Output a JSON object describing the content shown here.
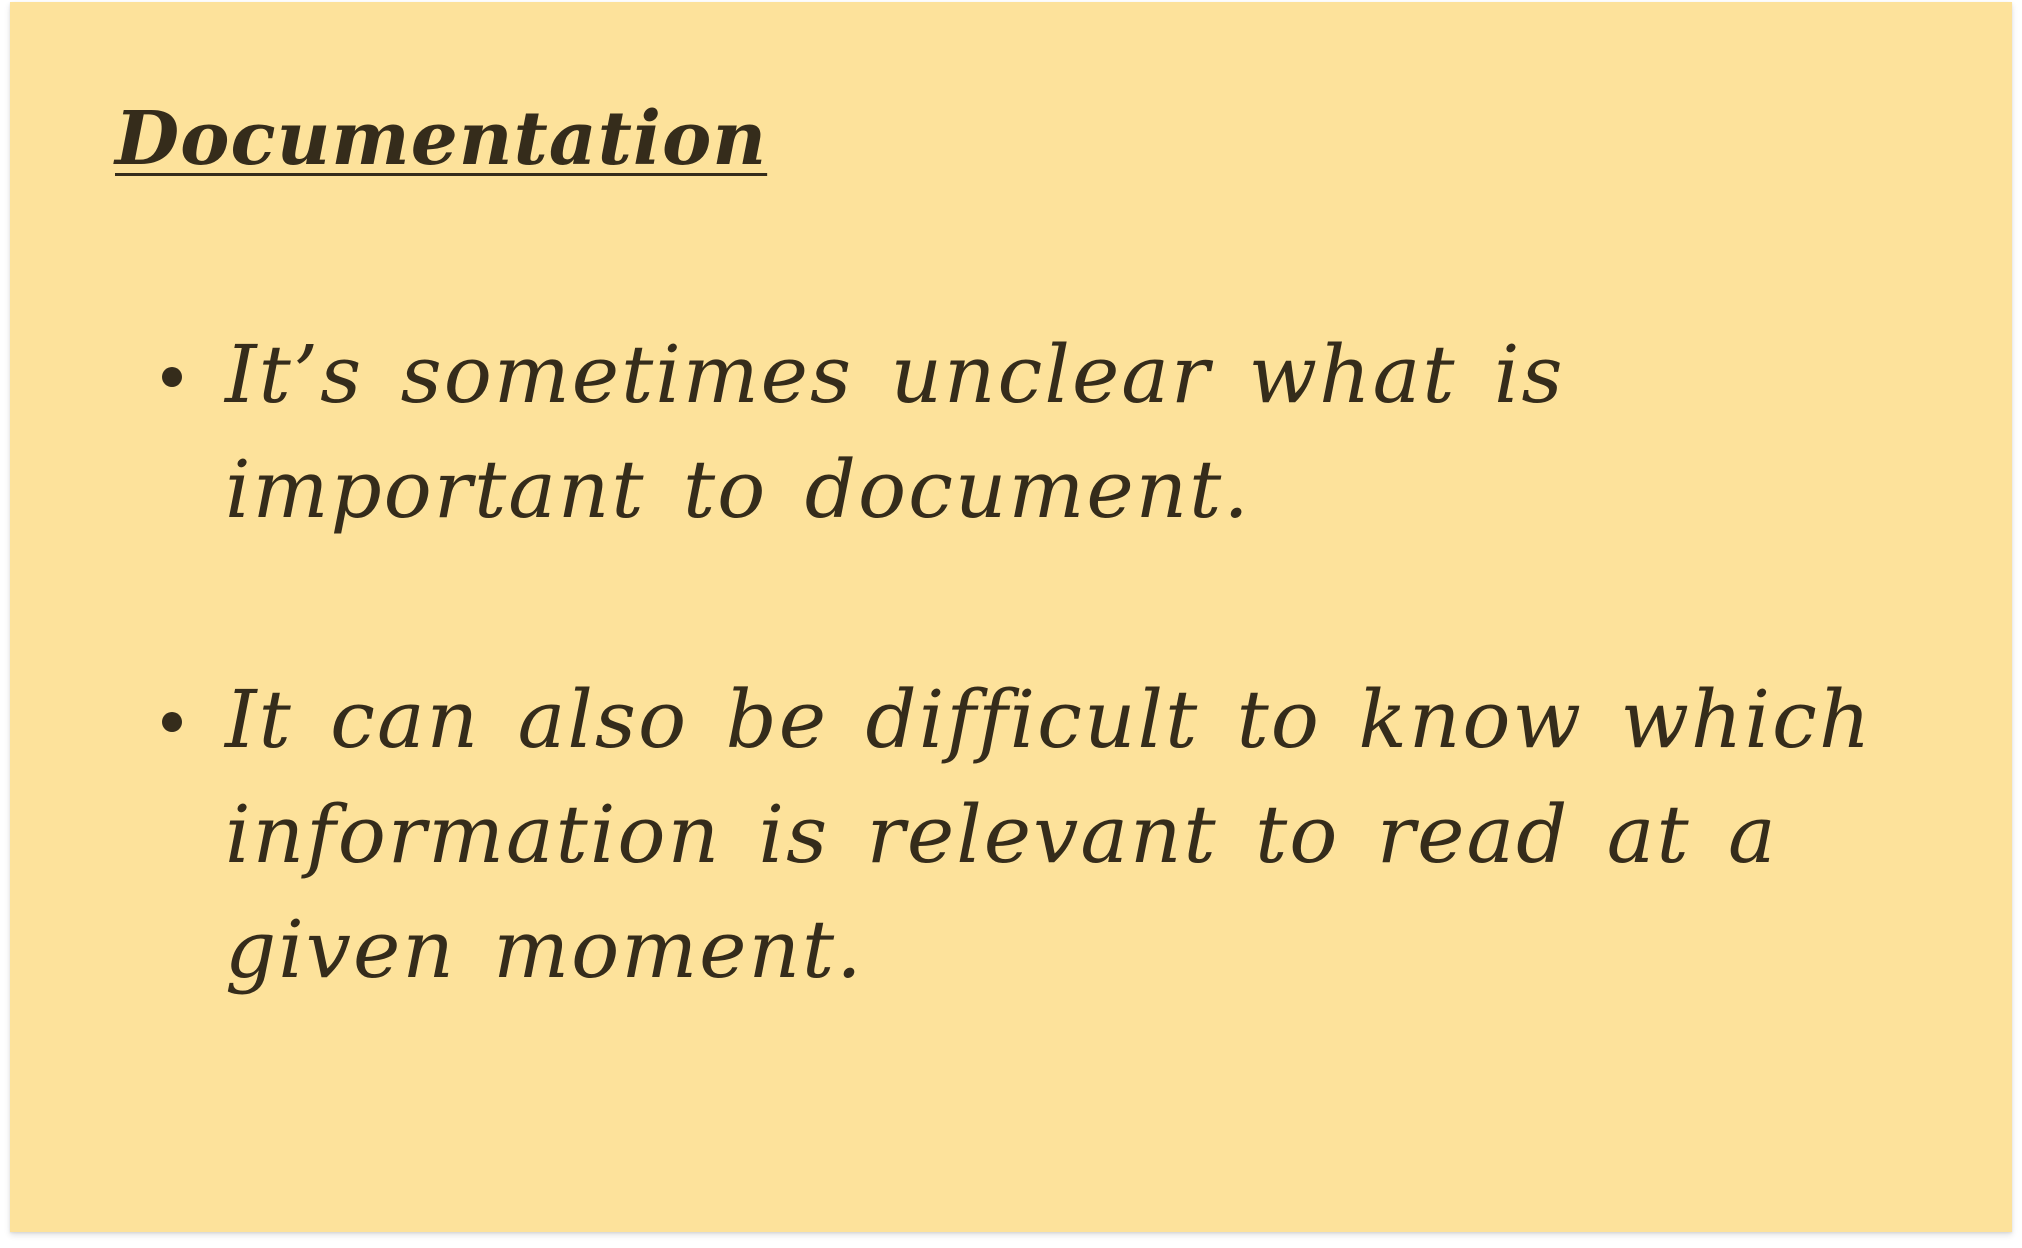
{
  "note": {
    "title": "Documentation",
    "background_color": "#fde29b",
    "text_color": "#352c1b",
    "bullets": [
      {
        "text": "It’s sometimes unclear what is important to document."
      },
      {
        "text": "It can also be difficult to know which information is relevant to read at a given moment."
      }
    ]
  }
}
